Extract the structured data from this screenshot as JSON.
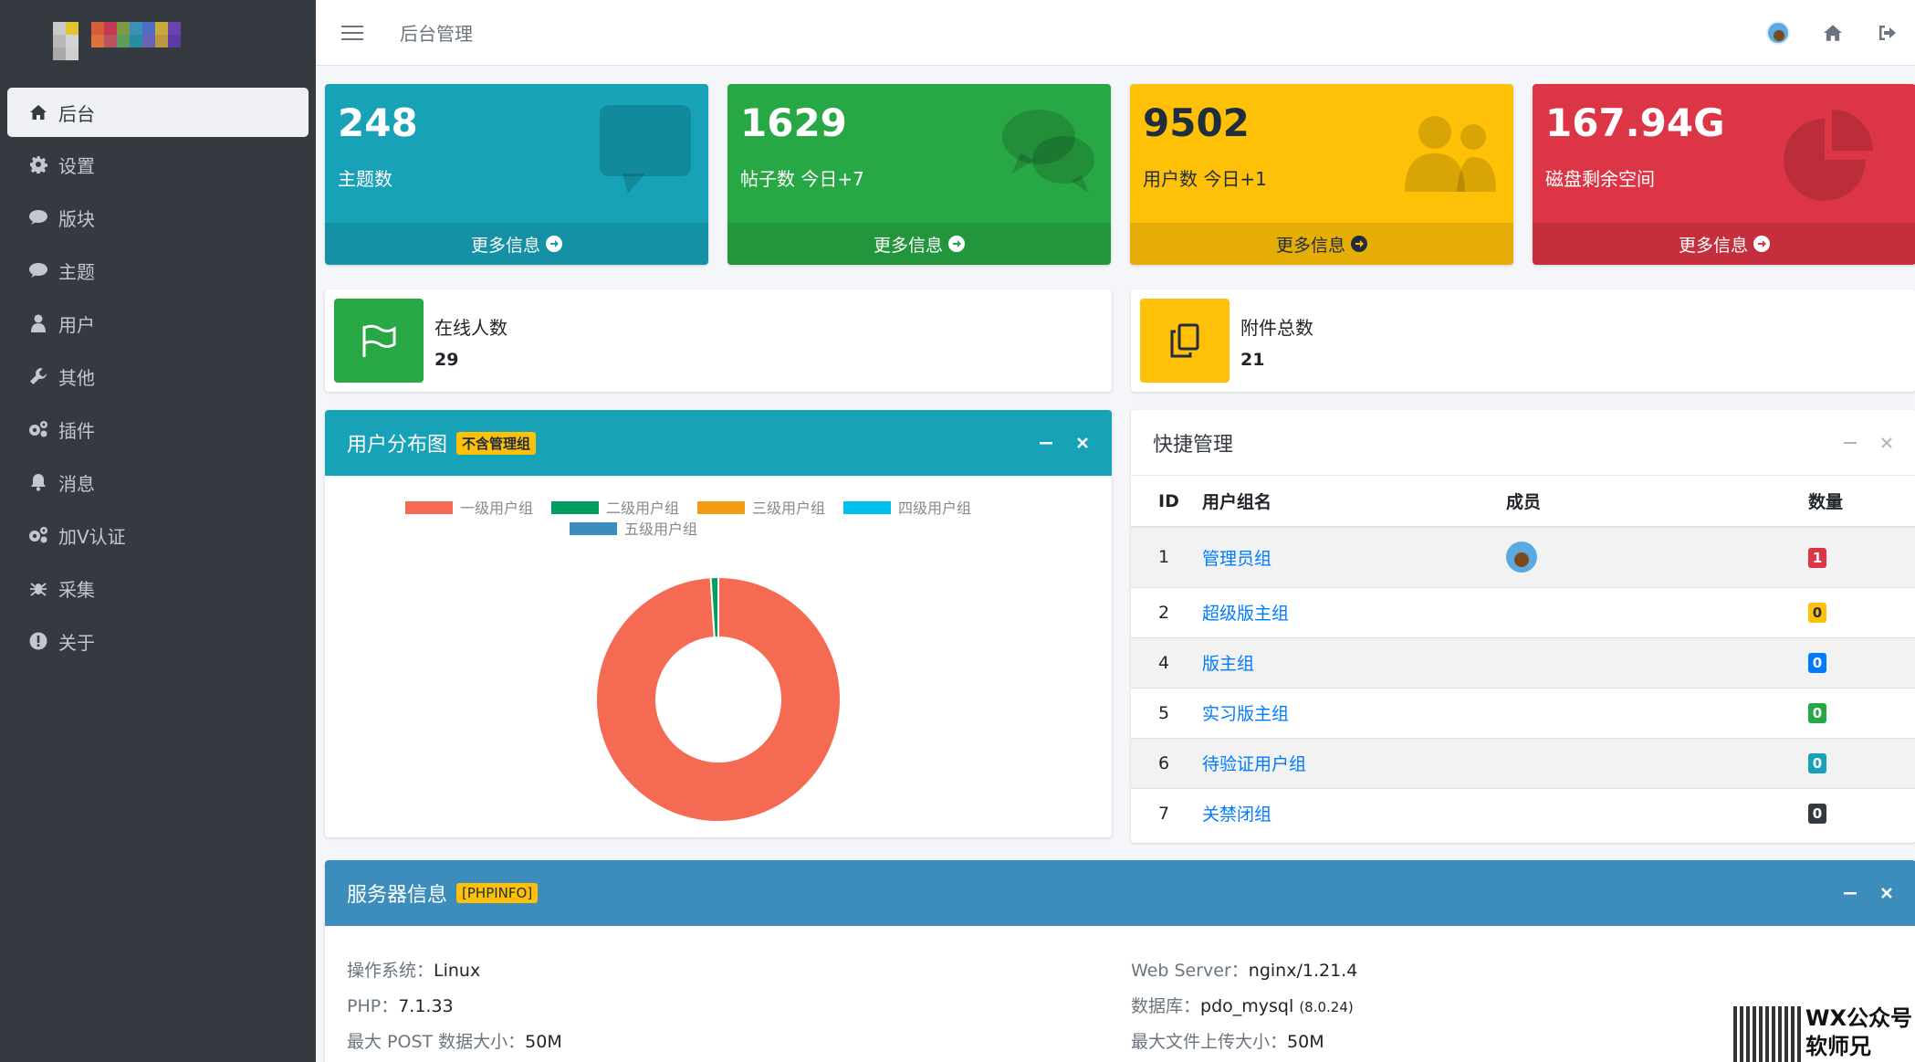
{
  "topbar": {
    "breadcrumb": "后台管理"
  },
  "sidebar": {
    "items": [
      {
        "label": "后台",
        "icon": "home-icon"
      },
      {
        "label": "设置",
        "icon": "gear-icon"
      },
      {
        "label": "版块",
        "icon": "comment-icon"
      },
      {
        "label": "主题",
        "icon": "comment-icon"
      },
      {
        "label": "用户",
        "icon": "user-icon"
      },
      {
        "label": "其他",
        "icon": "wrench-icon"
      },
      {
        "label": "插件",
        "icon": "gears-icon"
      },
      {
        "label": "消息",
        "icon": "bell-icon"
      },
      {
        "label": "加V认证",
        "icon": "gears-icon"
      },
      {
        "label": "采集",
        "icon": "spider-icon"
      },
      {
        "label": "关于",
        "icon": "exclamation-circle-icon"
      }
    ]
  },
  "stats": [
    {
      "value": "248",
      "label": "主题数",
      "more": "更多信息",
      "icon": "comment-bubble-icon",
      "color": "#17a2b8"
    },
    {
      "value": "1629",
      "label": "帖子数 今日+7",
      "more": "更多信息",
      "icon": "comments-icon",
      "color": "#28a745"
    },
    {
      "value": "9502",
      "label": "用户数 今日+1",
      "more": "更多信息",
      "icon": "users-icon",
      "color": "#ffc107"
    },
    {
      "value": "167.94G",
      "label": "磁盘剩余空间",
      "more": "更多信息",
      "icon": "pie-chart-icon",
      "color": "#dc3545"
    }
  ],
  "info_boxes": [
    {
      "label": "在线人数",
      "value": "29",
      "icon": "flag-icon",
      "color": "#28a745"
    },
    {
      "label": "附件总数",
      "value": "21",
      "icon": "copy-icon",
      "color": "#ffc107"
    }
  ],
  "chart_card": {
    "title": "用户分布图",
    "badge": "不含管理组"
  },
  "chart_data": {
    "type": "pie",
    "categories": [
      "一级用户组",
      "二级用户组",
      "三级用户组",
      "四级用户组",
      "五级用户组"
    ],
    "values": [
      99,
      1,
      0,
      0,
      0
    ],
    "colors": [
      "#f46a53",
      "#009e5f",
      "#f39c12",
      "#00c0ef",
      "#3c8dbc"
    ],
    "legend": "top"
  },
  "quick_card": {
    "title": "快捷管理",
    "columns": [
      "ID",
      "用户组名",
      "成员",
      "数量"
    ],
    "rows": [
      {
        "id": "1",
        "name": "管理员组",
        "count": "1",
        "color": "#dc3545",
        "has_member": true
      },
      {
        "id": "2",
        "name": "超级版主组",
        "count": "0",
        "color": "#ffc107",
        "has_member": false
      },
      {
        "id": "4",
        "name": "版主组",
        "count": "0",
        "color": "#007bff",
        "has_member": false
      },
      {
        "id": "5",
        "name": "实习版主组",
        "count": "0",
        "color": "#28a745",
        "has_member": false
      },
      {
        "id": "6",
        "name": "待验证用户组",
        "count": "0",
        "color": "#17a2b8",
        "has_member": false
      },
      {
        "id": "7",
        "name": "关禁闭组",
        "count": "0",
        "color": "#343a40",
        "has_member": false
      }
    ]
  },
  "server_card": {
    "title": "服务器信息",
    "badge": "[PHPINFO]",
    "left": [
      {
        "label": "操作系统：",
        "value": "Linux"
      },
      {
        "label": "PHP：",
        "value": "7.1.33"
      },
      {
        "label": "最大 POST 数据大小：",
        "value": "50M"
      }
    ],
    "right": [
      {
        "label": "Web Server：",
        "value": "nginx/1.21.4",
        "extra": ""
      },
      {
        "label": "数据库：",
        "value": "pdo_mysql",
        "extra": "(8.0.24)"
      },
      {
        "label": "最大文件上传大小：",
        "value": "50M",
        "extra": ""
      }
    ]
  },
  "watermark": {
    "line1": "WX公众号",
    "line2": "软师兄"
  }
}
